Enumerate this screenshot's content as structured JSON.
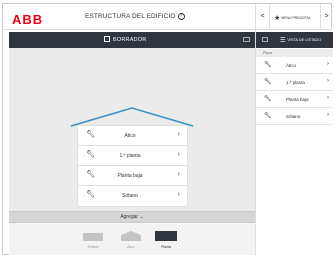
{
  "header": {
    "logo": "ABB",
    "title": "ESTRUCTURA DEL EDIFICIO",
    "help_icon": "?"
  },
  "nav": {
    "prev": "<",
    "main_menu": "MENÚ PRINCIPAL",
    "next": ">"
  },
  "toolbar": {
    "label": "BORRADOR"
  },
  "floors": [
    {
      "label": "Ático"
    },
    {
      "label": "1.ª planta"
    },
    {
      "label": "Planta baja"
    },
    {
      "label": "Sótano"
    }
  ],
  "add_bar": {
    "label": "Agregar ⌄"
  },
  "bottom_shapes": [
    {
      "label": "Sótano"
    },
    {
      "label": "Ático"
    },
    {
      "label": "Planta"
    }
  ],
  "right_panel": {
    "toolbar_label": "VISTA DE LISTADO",
    "section_label": "Pisos",
    "items": [
      {
        "label": "Ático"
      },
      {
        "label": "1.ª planta"
      },
      {
        "label": "Planta baja"
      },
      {
        "label": "Sótano"
      }
    ]
  },
  "colors": {
    "brand": "#e2001a",
    "toolbar": "#2f3640",
    "roof": "#3b8ec9",
    "active_shape": "#2f3640",
    "inactive_shape": "#c4c4c4"
  }
}
